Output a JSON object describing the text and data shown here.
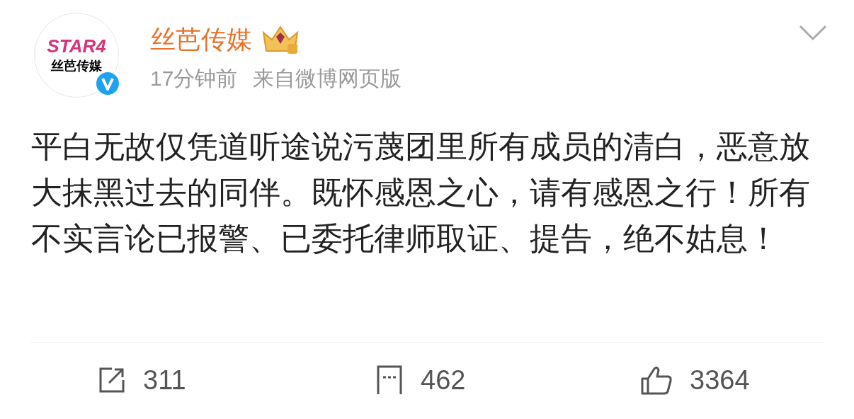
{
  "author": {
    "avatar": {
      "line_1": "STAR4",
      "line_2": "丝芭传媒",
      "verified": true
    },
    "name": "丝芭传媒",
    "time": "17分钟前",
    "source": "来自微博网页版"
  },
  "text": "平白无故仅凭道听途说污蔑团里所有成员的清白，恶意放大抹黑过去的同伴。既怀感恩之心，请有感恩之行！所有不实言论已报警、已委托律师取证、提告，绝不姑息！",
  "actions": [
    {
      "kind": "repost",
      "count": "311"
    },
    {
      "kind": "comment",
      "count": "462"
    },
    {
      "kind": "like",
      "count": "3364"
    }
  ]
}
